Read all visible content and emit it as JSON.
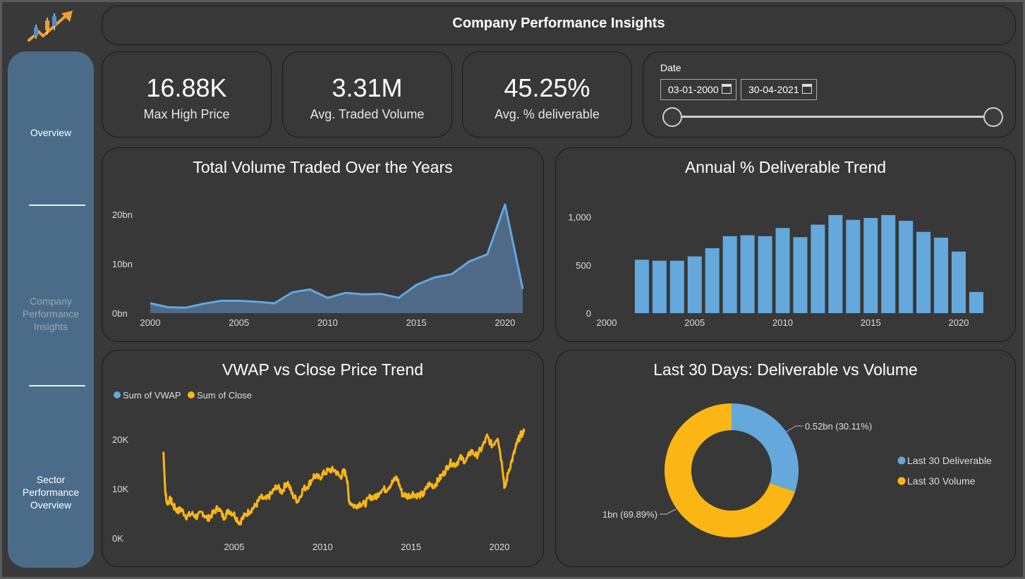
{
  "header": {
    "title": "Company Performance Insights"
  },
  "logo": {
    "icon": "candlestick-arrow-logo",
    "colors": [
      "#f0a030",
      "#4a90d0"
    ]
  },
  "sidebar": {
    "items": [
      {
        "label": "Overview",
        "active": true
      },
      {
        "label": "Company Performance Insights",
        "active": false
      },
      {
        "label": "Sector Performance Overview",
        "active": true
      }
    ]
  },
  "kpis": [
    {
      "value": "16.88K",
      "label": "Max High Price"
    },
    {
      "value": "3.31M",
      "label": "Avg. Traded Volume"
    },
    {
      "value": "45.25%",
      "label": "Avg. % deliverable"
    }
  ],
  "date_filter": {
    "label": "Date",
    "start": "03-01-2000",
    "end": "30-04-2021",
    "icon": "calendar-icon"
  },
  "colors": {
    "blue": "#64a8dc",
    "yellow": "#fbb616",
    "area_fill": "#4f6a86",
    "panel": "#383838"
  },
  "chart_data": [
    {
      "id": "volume",
      "type": "area",
      "title": "Total Volume Traded Over the Years",
      "x": [
        2000,
        2001,
        2002,
        2003,
        2004,
        2005,
        2006,
        2007,
        2008,
        2009,
        2010,
        2011,
        2012,
        2013,
        2014,
        2015,
        2016,
        2017,
        2018,
        2019,
        2020,
        2021
      ],
      "values": [
        2.0,
        1.2,
        1.1,
        1.9,
        2.5,
        2.5,
        2.3,
        2.0,
        4.2,
        4.8,
        3.1,
        4.1,
        3.8,
        3.9,
        3.1,
        5.7,
        7.2,
        7.9,
        10.5,
        11.9,
        22.0,
        4.9
      ],
      "value_unit": "bn",
      "ylim": [
        0,
        22
      ],
      "yticks": [
        "0bn",
        "10bn",
        "20bn"
      ],
      "xticks": [
        "2000",
        "2005",
        "2010",
        "2015",
        "2020"
      ]
    },
    {
      "id": "deliverable",
      "type": "bar",
      "title": "Annual % Deliverable Trend",
      "categories": [
        2002,
        2003,
        2004,
        2005,
        2006,
        2007,
        2008,
        2009,
        2010,
        2011,
        2012,
        2013,
        2014,
        2015,
        2016,
        2017,
        2018,
        2019,
        2020,
        2021
      ],
      "values": [
        555,
        545,
        545,
        590,
        675,
        800,
        810,
        800,
        885,
        790,
        920,
        1020,
        970,
        990,
        1020,
        960,
        845,
        785,
        640,
        220
      ],
      "ylim": [
        0,
        1100
      ],
      "yticks": [
        "0",
        "500",
        "1,000"
      ],
      "xticks": [
        "2000",
        "2005",
        "2010",
        "2015",
        "2020"
      ]
    },
    {
      "id": "vwap_close",
      "type": "line",
      "title": "VWAP vs Close Price Trend",
      "series": [
        {
          "name": "Sum of VWAP",
          "color": "#64a8dc"
        },
        {
          "name": "Sum of Close",
          "color": "#fbb616"
        }
      ],
      "x": [
        2001.0,
        2001.1,
        2001.2,
        2001.4,
        2001.6,
        2001.8,
        2002.0,
        2002.3,
        2002.6,
        2002.9,
        2003.2,
        2003.5,
        2003.8,
        2004.1,
        2004.4,
        2004.7,
        2005.0,
        2005.3,
        2005.6,
        2005.9,
        2006.2,
        2006.5,
        2006.8,
        2007.1,
        2007.4,
        2007.7,
        2008.0,
        2008.3,
        2008.6,
        2008.9,
        2009.2,
        2009.5,
        2009.8,
        2010.1,
        2010.4,
        2010.7,
        2011.0,
        2011.2,
        2011.35,
        2011.5,
        2011.8,
        2012.1,
        2012.4,
        2012.7,
        2013.0,
        2013.3,
        2013.6,
        2013.9,
        2014.2,
        2014.5,
        2014.8,
        2015.1,
        2015.4,
        2015.7,
        2016.0,
        2016.3,
        2016.6,
        2016.9,
        2017.2,
        2017.5,
        2017.8,
        2018.1,
        2018.4,
        2018.7,
        2019.0,
        2019.3,
        2019.6,
        2019.9,
        2020.2,
        2020.3,
        2020.5,
        2020.8,
        2021.0,
        2021.2,
        2021.4
      ],
      "values": [
        17500,
        9500,
        7200,
        7800,
        6300,
        5500,
        5800,
        4400,
        4900,
        4300,
        5200,
        3900,
        5000,
        6200,
        4200,
        5600,
        4800,
        3100,
        4600,
        5600,
        6500,
        8200,
        7800,
        9000,
        10500,
        9400,
        11500,
        8700,
        7500,
        9900,
        10700,
        12600,
        12200,
        13200,
        13800,
        13700,
        12300,
        13500,
        12800,
        7500,
        6400,
        7000,
        6900,
        8400,
        8200,
        9800,
        9900,
        11100,
        12300,
        9000,
        8500,
        9000,
        8600,
        8900,
        10900,
        10600,
        12000,
        13400,
        15300,
        14900,
        16200,
        15600,
        17600,
        16700,
        18200,
        20500,
        18700,
        20600,
        13600,
        9800,
        13500,
        16800,
        19300,
        20900,
        21500
      ],
      "ylim": [
        0,
        22000
      ],
      "yticks": [
        "0K",
        "10K",
        "20K"
      ],
      "xticks": [
        "2005",
        "2010",
        "2015",
        "2020"
      ]
    },
    {
      "id": "last30",
      "type": "pie",
      "title": "Last 30 Days: Deliverable vs Volume",
      "slices": [
        {
          "name": "Last 30 Deliverable",
          "value": 30.11,
          "label": "0.52bn (30.11%)",
          "color": "#64a8dc"
        },
        {
          "name": "Last 30 Volume",
          "value": 69.89,
          "label": "1bn (69.89%)",
          "color": "#fbb616"
        }
      ]
    }
  ]
}
